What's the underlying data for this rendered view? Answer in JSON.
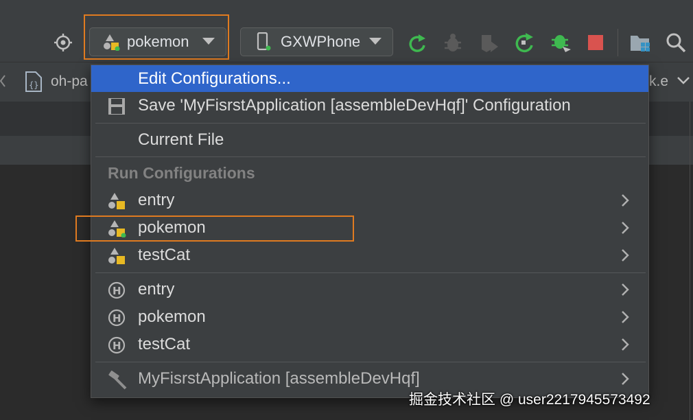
{
  "toolbar": {
    "run_config": {
      "label": "pokemon"
    },
    "device": {
      "label": "GXWPhone"
    }
  },
  "tabs": [
    {
      "label": "oh-pa"
    },
    {
      "label": "k.e"
    }
  ],
  "popup": {
    "edit_configurations": "Edit Configurations...",
    "save_configuration": "Save 'MyFisrstApplication [assembleDevHqf]' Configuration",
    "current_file": "Current File",
    "run_configurations_header": "Run Configurations",
    "run_configurations": [
      {
        "label": "entry",
        "icon": "module-config-icon"
      },
      {
        "label": "pokemon",
        "icon": "module-config-running-icon"
      },
      {
        "label": "testCat",
        "icon": "module-config-icon"
      }
    ],
    "hvigor_configurations": [
      {
        "label": "entry",
        "icon": "hvigor-h-icon"
      },
      {
        "label": "pokemon",
        "icon": "hvigor-h-icon"
      },
      {
        "label": "testCat",
        "icon": "hvigor-h-icon"
      }
    ],
    "build_task": {
      "label": "MyFisrstApplication [assembleDevHqf]",
      "icon": "hammer-icon"
    }
  },
  "colors": {
    "selection": "#2f65ca",
    "highlight_border": "#e07b20",
    "run_green": "#3fb950",
    "stop_red": "#d9534f"
  },
  "watermark": "掘金技术社区 @ user2217945573492"
}
